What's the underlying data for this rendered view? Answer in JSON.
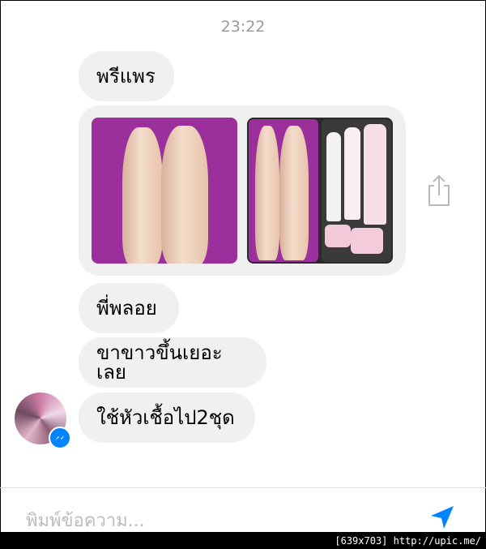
{
  "timestamp": "23:22",
  "messages": [
    {
      "text": "พรีแพร"
    },
    {
      "text": "พี่พลอย"
    },
    {
      "text": "ขาขาวขึ้นเยอะเลย"
    },
    {
      "text": "ใช้หัวเชื้อไป2ชุด"
    }
  ],
  "composer": {
    "placeholder": "พิมพ์ข้อความ..."
  },
  "watermark": "[639x703] http://upic.me/",
  "colors": {
    "bubble": "#f1f0f0",
    "accent": "#0084ff"
  },
  "icons": {
    "share": "share-icon",
    "send": "send-icon",
    "messenger": "messenger-badge-icon"
  }
}
